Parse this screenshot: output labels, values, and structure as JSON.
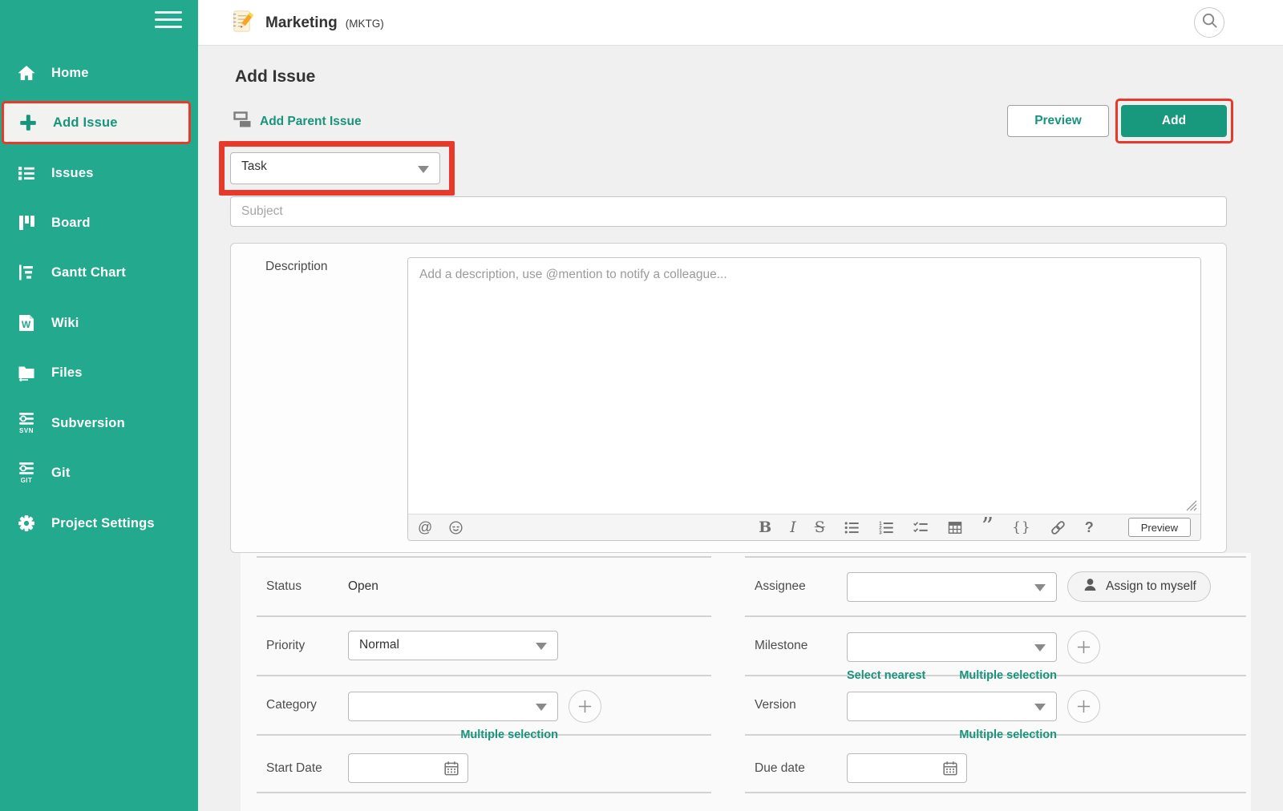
{
  "colors": {
    "sidebar_teal": "#23a98d",
    "accent_green": "#17947c",
    "add_button_green": "#18997e",
    "annotation_red": "#e8392b"
  },
  "sidebar": {
    "items": [
      {
        "label": "Home"
      },
      {
        "label": "Add Issue",
        "selected": true
      },
      {
        "label": "Issues"
      },
      {
        "label": "Board"
      },
      {
        "label": "Gantt Chart"
      },
      {
        "label": "Wiki",
        "icon_letter": "W"
      },
      {
        "label": "Files"
      },
      {
        "label": "Subversion",
        "badge": "SVN"
      },
      {
        "label": "Git",
        "badge": "GIT"
      },
      {
        "label": "Project Settings"
      }
    ]
  },
  "header": {
    "project_name": "Marketing",
    "project_key": "(MKTG)"
  },
  "page": {
    "title": "Add Issue",
    "add_parent_issue_label": "Add Parent Issue",
    "preview_button_label": "Preview",
    "add_button_label": "Add"
  },
  "form": {
    "issue_type_value": "Task",
    "subject_placeholder": "Subject",
    "description": {
      "label": "Description",
      "placeholder": "Add a description, use @mention to notify a colleague...",
      "toolbar": {
        "mention": "@",
        "bold": "B",
        "italic": "I",
        "strikethrough": "S",
        "quote": "”",
        "braces": "{}",
        "help": "?",
        "preview_button_label": "Preview"
      }
    },
    "fields": {
      "status": {
        "label": "Status",
        "value": "Open"
      },
      "priority": {
        "label": "Priority",
        "value": "Normal"
      },
      "category": {
        "label": "Category",
        "multiple_selection_link": "Multiple selection"
      },
      "start_date": {
        "label": "Start Date"
      },
      "assignee": {
        "label": "Assignee",
        "assign_to_myself_label": "Assign to myself"
      },
      "milestone": {
        "label": "Milestone",
        "select_nearest_link": "Select nearest",
        "multiple_selection_link": "Multiple selection"
      },
      "version": {
        "label": "Version",
        "multiple_selection_link": "Multiple selection"
      },
      "due_date": {
        "label": "Due date"
      }
    }
  }
}
